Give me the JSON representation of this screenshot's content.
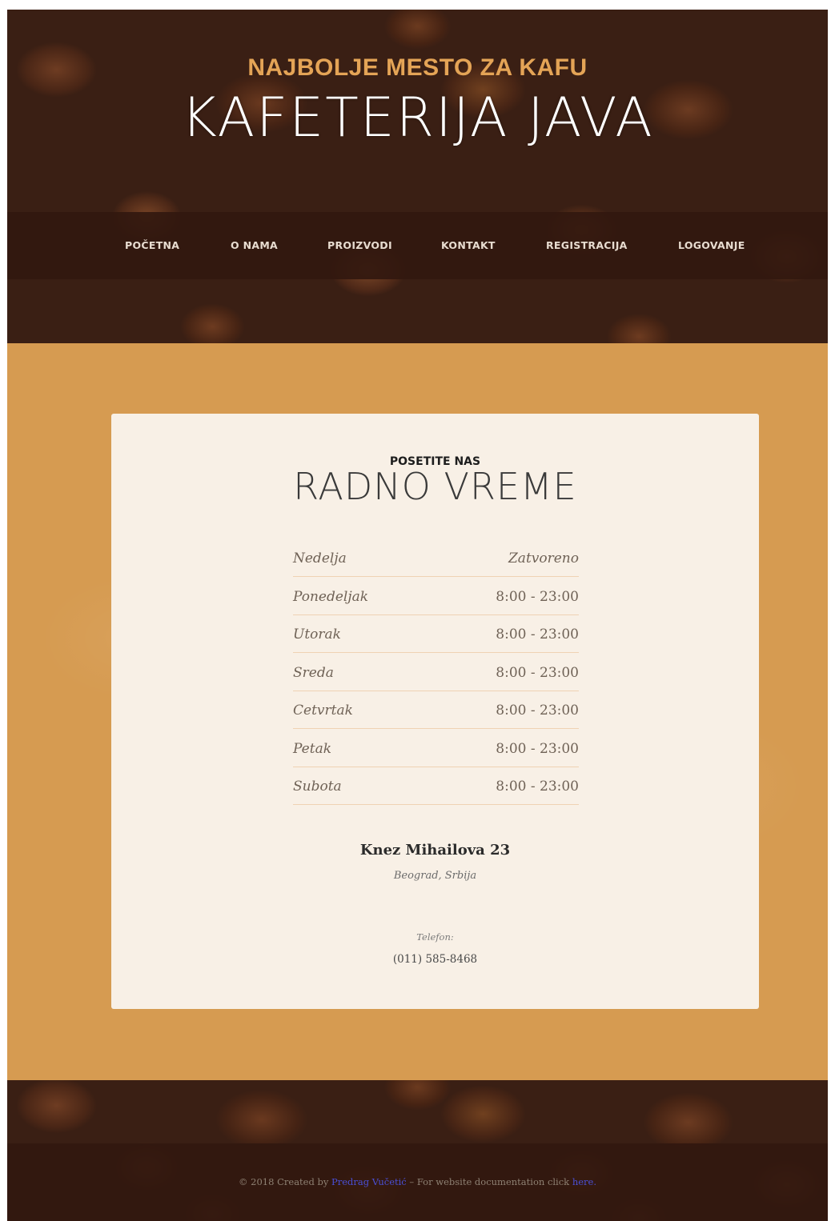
{
  "header": {
    "tagline": "NAJBOLJE MESTO ZA KAFU",
    "title": "KAFETERIJA JAVA"
  },
  "nav": {
    "items": [
      {
        "label": "POČETNA"
      },
      {
        "label": "O NAMA"
      },
      {
        "label": "PROIZVODI"
      },
      {
        "label": "KONTAKT"
      },
      {
        "label": "REGISTRACIJA"
      },
      {
        "label": "LOGOVANJE"
      }
    ]
  },
  "card": {
    "subtitle": "POSETITE NAS",
    "heading": "RADNO VREME",
    "hours": [
      {
        "day": "Nedelja",
        "time": "Zatvoreno"
      },
      {
        "day": "Ponedeljak",
        "time": "8:00 - 23:00"
      },
      {
        "day": "Utorak",
        "time": "8:00 - 23:00"
      },
      {
        "day": "Sreda",
        "time": "8:00 - 23:00"
      },
      {
        "day": "Cetvrtak",
        "time": "8:00 - 23:00"
      },
      {
        "day": "Petak",
        "time": "8:00 - 23:00"
      },
      {
        "day": "Subota",
        "time": "8:00 - 23:00"
      }
    ],
    "address": "Knez Mihailova 23",
    "city": "Beograd, Srbija",
    "phone_label": "Telefon:",
    "phone": "(011) 585-8468"
  },
  "footer": {
    "prefix": "© 2018 Created by ",
    "author": "Predrag Vučetić",
    "middle": " – For website documentation click ",
    "doc_link": "here."
  },
  "colors": {
    "accent": "#e4a456",
    "main_bg": "#d69b51",
    "card_bg": "#f8f0e6",
    "nav_bg": "#32180f",
    "link": "#4a4fd6"
  }
}
